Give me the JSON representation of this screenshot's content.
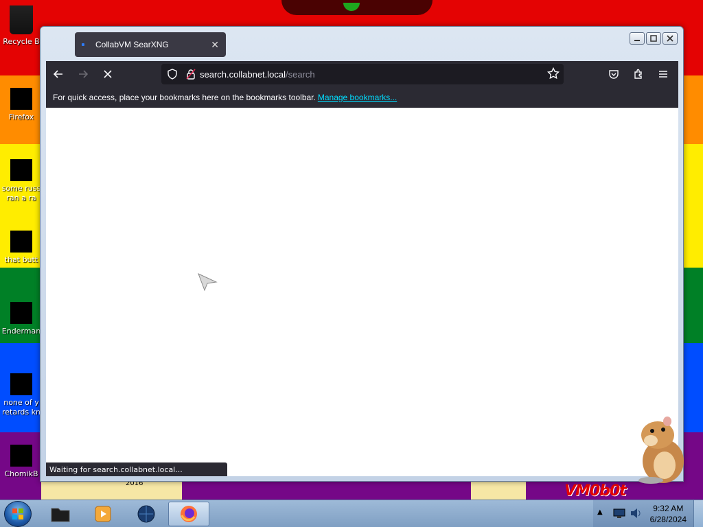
{
  "desktop": {
    "icons": [
      {
        "label": "Recycle B"
      },
      {
        "label": "Firefox"
      },
      {
        "label": "some russ",
        "label2": "ran a ra"
      },
      {
        "label": "that butt"
      },
      {
        "label": "Enderman"
      },
      {
        "label": "none of y",
        "label2": "retards kn"
      },
      {
        "label": "ChomikB"
      }
    ],
    "year_label": "2016",
    "watermark": "VM0b0t"
  },
  "browser": {
    "tab_title": "CollabVM SearXNG",
    "url_host": "search.collabnet.local",
    "url_path": "/search",
    "bookmarks_text": "For quick access, place your bookmarks here on the bookmarks toolbar.",
    "bookmarks_link": "Manage bookmarks...",
    "status_text": "Waiting for search.collabnet.local..."
  },
  "taskbar": {
    "time": "9:32 AM",
    "date": "6/28/2024"
  },
  "colors": {
    "firefox_chrome": "#2b2a33",
    "urlbar_bg": "#1c1b22",
    "link": "#00ddff",
    "favicon": "#2e7bf6"
  }
}
